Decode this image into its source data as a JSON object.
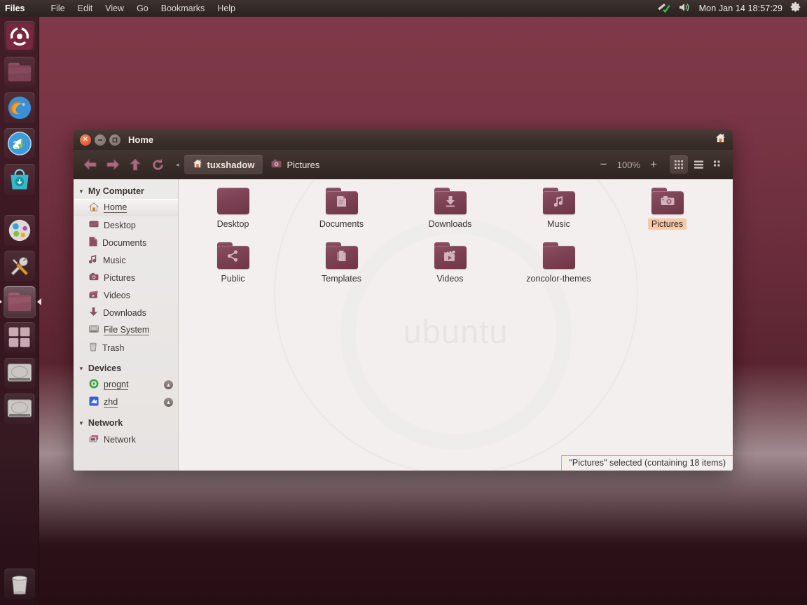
{
  "panel": {
    "app_name": "Files",
    "menus": [
      "File",
      "Edit",
      "View",
      "Go",
      "Bookmarks",
      "Help"
    ],
    "indicators": [
      "network-icon",
      "volume-icon",
      "gear-icon"
    ],
    "clock": "Mon Jan 14  18:57:29"
  },
  "launcher": {
    "items": [
      {
        "name": "ubuntu-dash-icon",
        "label": "Dash Home",
        "active": false
      },
      {
        "name": "files-folder-icon",
        "label": "Files",
        "active": false
      },
      {
        "name": "firefox-icon",
        "label": "Firefox Web Browser",
        "active": false
      },
      {
        "name": "rhythmbox-icon",
        "label": "Rhythmbox",
        "active": false
      },
      {
        "name": "software-center-icon",
        "label": "Ubuntu Software Center",
        "active": false
      },
      {
        "name": "system-settings-icon",
        "label": "System Settings",
        "active": false
      },
      {
        "name": "tools-icon",
        "label": "Tools",
        "active": false
      },
      {
        "name": "files-active-icon",
        "label": "Files",
        "active": true
      },
      {
        "name": "workspace-switcher-icon",
        "label": "Workspace Switcher",
        "active": false
      },
      {
        "name": "disk-prognt-icon",
        "label": "prognt",
        "active": false
      },
      {
        "name": "disk-zhd-icon",
        "label": "zhd",
        "active": false
      },
      {
        "name": "trash-icon",
        "label": "Trash",
        "active": false
      }
    ]
  },
  "window": {
    "title": "Home",
    "controls": {
      "close": "✕",
      "minimize": "–",
      "maximize": "▢"
    },
    "home_indicator": "home-icon"
  },
  "toolbar": {
    "back_label": "Back",
    "forward_label": "Forward",
    "up_label": "Up",
    "reload_label": "Reload",
    "breadcrumb_overflow": "◂",
    "breadcrumbs": [
      {
        "label": "tuxshadow",
        "icon": "home-icon",
        "active": true
      },
      {
        "label": "Pictures",
        "icon": "camera-icon",
        "active": false
      }
    ],
    "zoom_out": "−",
    "zoom_level": "100%",
    "zoom_in": "+",
    "views": [
      {
        "name": "icon-view",
        "active": true
      },
      {
        "name": "list-view",
        "active": false
      },
      {
        "name": "compact-view",
        "active": false
      }
    ]
  },
  "sidebar": {
    "sections": [
      {
        "title": "My Computer",
        "expanded": true,
        "items": [
          {
            "label": "Home",
            "icon": "home-icon",
            "selected": true,
            "underline": true
          },
          {
            "label": "Desktop",
            "icon": "desktop-icon",
            "selected": false,
            "underline": false
          },
          {
            "label": "Documents",
            "icon": "documents-icon",
            "selected": false,
            "underline": false
          },
          {
            "label": "Music",
            "icon": "music-icon",
            "selected": false,
            "underline": false
          },
          {
            "label": "Pictures",
            "icon": "pictures-icon",
            "selected": false,
            "underline": false
          },
          {
            "label": "Videos",
            "icon": "videos-icon",
            "selected": false,
            "underline": false
          },
          {
            "label": "Downloads",
            "icon": "downloads-icon",
            "selected": false,
            "underline": false
          },
          {
            "label": "File System",
            "icon": "harddisk-icon",
            "selected": false,
            "underline": true
          },
          {
            "label": "Trash",
            "icon": "trash-icon",
            "selected": false,
            "underline": false
          }
        ]
      },
      {
        "title": "Devices",
        "expanded": true,
        "items": [
          {
            "label": "prognt",
            "icon": "cdrom-icon",
            "selected": false,
            "underline": true,
            "eject": true
          },
          {
            "label": "zhd",
            "icon": "drive-icon",
            "selected": false,
            "underline": true,
            "eject": true
          }
        ]
      },
      {
        "title": "Network",
        "expanded": true,
        "items": [
          {
            "label": "Network",
            "icon": "network-icon",
            "selected": false,
            "underline": false
          }
        ]
      }
    ]
  },
  "content": {
    "watermark": "ubuntu",
    "files": [
      {
        "label": "Desktop",
        "icon": "desktop-folder-icon",
        "glyph": "",
        "selected": false,
        "plain": true
      },
      {
        "label": "Documents",
        "icon": "documents-folder-icon",
        "glyph": "Ὄ4",
        "selected": false
      },
      {
        "label": "Downloads",
        "icon": "downloads-folder-icon",
        "glyph": "⬇",
        "selected": false
      },
      {
        "label": "Music",
        "icon": "music-folder-icon",
        "glyph": "♫",
        "selected": false
      },
      {
        "label": "Pictures",
        "icon": "pictures-folder-icon",
        "glyph": "◉",
        "selected": true
      },
      {
        "label": "Public",
        "icon": "public-folder-icon",
        "glyph": "≪",
        "selected": false
      },
      {
        "label": "Templates",
        "icon": "templates-folder-icon",
        "glyph": "❐",
        "selected": false
      },
      {
        "label": "Videos",
        "icon": "videos-folder-icon",
        "glyph": "▶",
        "selected": false
      },
      {
        "label": "zoncolor-themes",
        "icon": "plain-folder-icon",
        "glyph": "",
        "selected": false,
        "plain": true
      }
    ]
  },
  "status": {
    "text": "\"Pictures\" selected (containing 18 items)"
  },
  "colors": {
    "desktop_top": "#80394a",
    "desktop_bottom": "#270d14",
    "panel": "#332926",
    "folder": "#7c4154",
    "selection": "#f6c9ab"
  }
}
